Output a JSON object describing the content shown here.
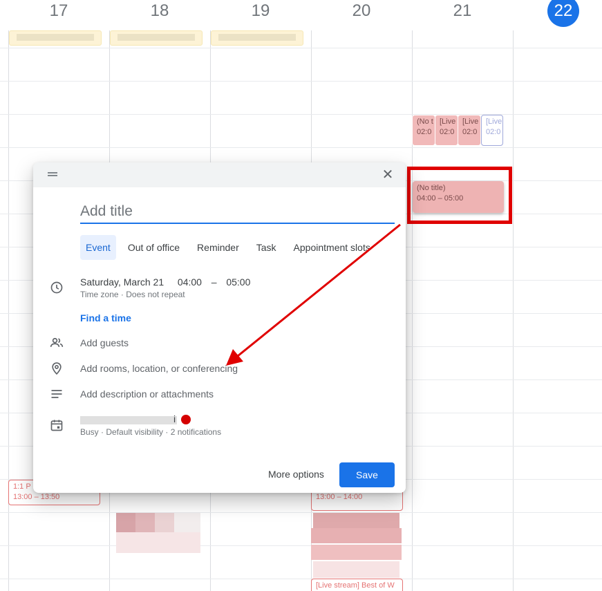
{
  "days": [
    {
      "num": "17"
    },
    {
      "num": "18"
    },
    {
      "num": "19"
    },
    {
      "num": "20"
    },
    {
      "num": "21"
    },
    {
      "num": "22",
      "today": true
    }
  ],
  "events": {
    "e21a": {
      "l1": "(No t",
      "l2": "02:0"
    },
    "e21b": {
      "l1": "[Live",
      "l2": "02:0"
    },
    "e21c": {
      "l1": "[Live",
      "l2": "02:0"
    },
    "e21d": {
      "l1": "[Live",
      "l2": "02:0"
    },
    "selected": {
      "l1": "(No title)",
      "l2": "04:00 – 05:00"
    },
    "e17": {
      "l1": "1:1 P",
      "l2": "13:00 – 13:50"
    },
    "e20a": {
      "l2": "13:00 – 14:00"
    },
    "e20b": {
      "l1": "[Live stream] Best of W"
    }
  },
  "dialog": {
    "title_placeholder": "Add title",
    "tabs": [
      "Event",
      "Out of office",
      "Reminder",
      "Task",
      "Appointment slots"
    ],
    "date": "Saturday, March 21",
    "start": "04:00",
    "dash": "–",
    "end": "05:00",
    "tz_info": "Time zone · Does not repeat",
    "find_time": "Find a time",
    "guests": "Add guests",
    "location": "Add rooms, location, or conferencing",
    "description": "Add description or attachments",
    "cal_suffix": "i",
    "cal_info": "Busy · Default visibility · 2 notifications",
    "more_options": "More options",
    "save": "Save"
  },
  "colors": {
    "accent": "#1a73e8",
    "event_pink": "#f1b9b9",
    "annotation_red": "#e00000",
    "calendar_dot": "#d50000"
  }
}
